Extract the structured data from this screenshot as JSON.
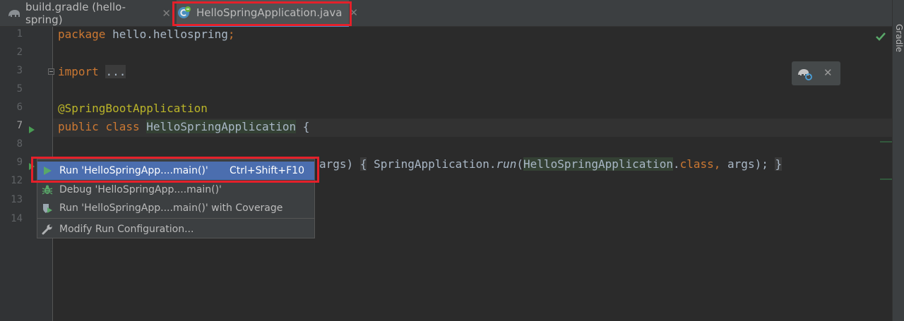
{
  "tabs": [
    {
      "label": "build.gradle (hello-spring)",
      "icon": "gradle-elephant-icon"
    },
    {
      "label": "HelloSpringApplication.java",
      "icon": "java-class-icon",
      "active": true
    }
  ],
  "right_toolwindow": {
    "label": "Gradle"
  },
  "line_numbers": [
    "1",
    "2",
    "3",
    "5",
    "6",
    "7",
    "8",
    "9",
    "12",
    "13",
    "14"
  ],
  "code": {
    "line1": {
      "kw": "package",
      "rest": " hello.hellospring",
      "semi": ";"
    },
    "line3": {
      "kw": "import",
      "folded": "..."
    },
    "line6": {
      "annotation": "@SpringBootApplication"
    },
    "line7": {
      "kw1": "public",
      "kw2": "class",
      "name": "HelloSpringApplication",
      "brace": " {"
    },
    "line9": {
      "partial": "args)",
      "open": "{",
      "call_owner": " SpringApplication.",
      "call_method": "run",
      "paren": "(",
      "ref": "HelloSpringApplication",
      "dot": ".",
      "class_kw": "class",
      "comma": ",",
      "args": " args);",
      "close": "}"
    }
  },
  "context_menu": {
    "items": [
      {
        "label": "Run 'HelloSpringApp....main()'",
        "shortcut": "Ctrl+Shift+F10",
        "icon": "run-icon",
        "selected": true
      },
      {
        "label": "Debug 'HelloSpringApp....main()'",
        "icon": "debug-icon"
      },
      {
        "label": "Run 'HelloSpringApp....main()' with Coverage",
        "icon": "coverage-icon"
      },
      {
        "label": "Modify Run Configuration...",
        "icon": "wrench-icon"
      }
    ]
  },
  "colors": {
    "accent": "#4a88c7",
    "selection": "#4b6eaf",
    "highlight_border": "#e5202a",
    "run_green": "#499c54"
  }
}
